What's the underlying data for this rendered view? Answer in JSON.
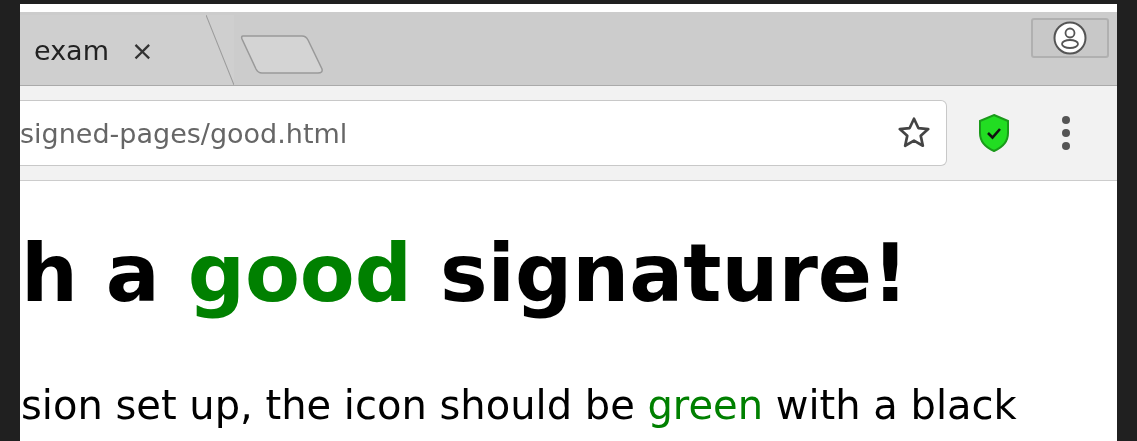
{
  "tabs": [
    {
      "title": "exam",
      "selected": true,
      "close": "×"
    }
  ],
  "address_bar": {
    "url": "signed-pages/good.html",
    "bookmarked": false
  },
  "extension": {
    "verified": true
  },
  "page": {
    "heading": [
      {
        "text": "h a ",
        "highlight": false
      },
      {
        "text": "good",
        "highlight": true
      },
      {
        "text": " signature!",
        "highlight": false
      }
    ],
    "paragraph": [
      {
        "text": "sion set up, the icon should be ",
        "highlight": false
      },
      {
        "text": "green",
        "highlight": true
      },
      {
        "text": " with a black",
        "highlight": false
      }
    ]
  }
}
